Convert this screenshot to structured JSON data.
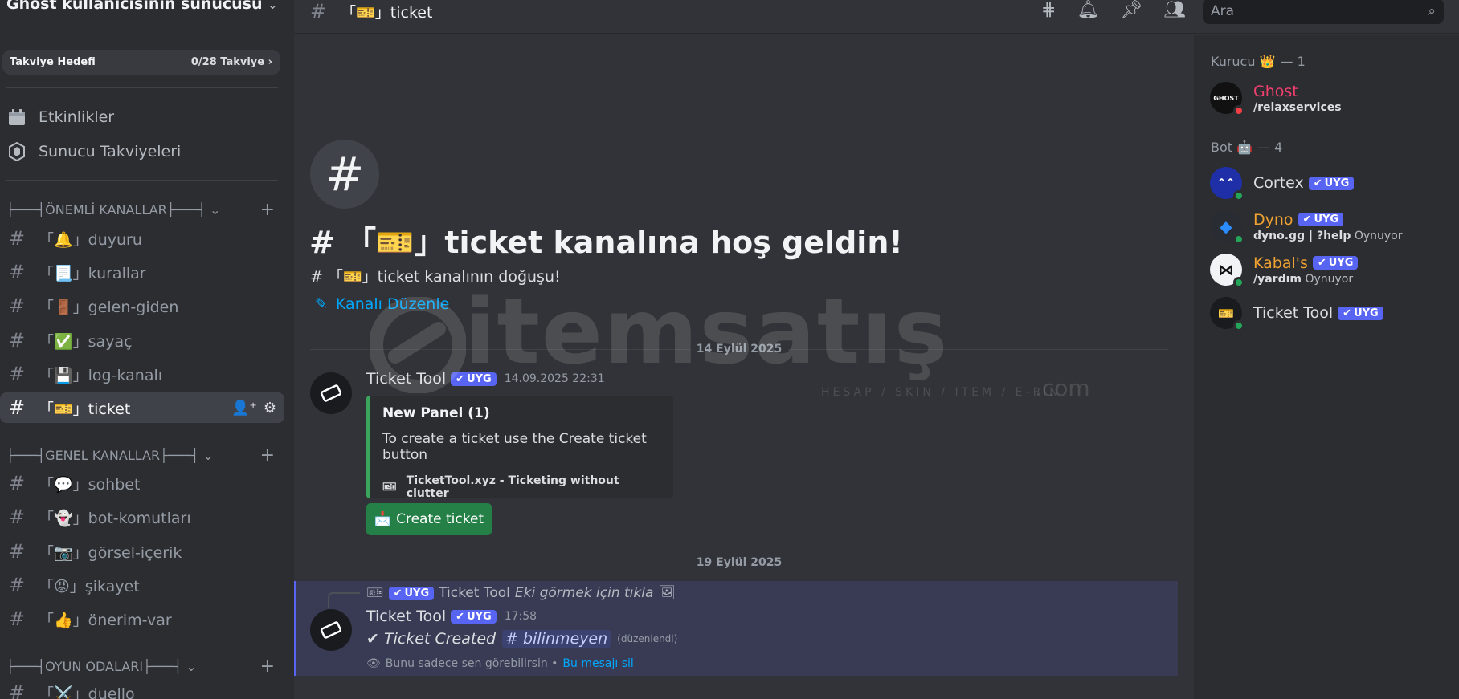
{
  "server": {
    "name": "Ghost kullanıcısının sunucusu"
  },
  "boost": {
    "label": "Takviye Hedefi",
    "count": "0/28 Takviye"
  },
  "sidebar_links": [
    {
      "label": "Etkinlikler",
      "icon": "calendar-icon"
    },
    {
      "label": "Sunucu Takviyeleri",
      "icon": "boost-icon"
    }
  ],
  "categories": {
    "important": "├───┤ÖNEMLİ KANALLAR├───┤",
    "general": "├───┤GENEL KANALLAR├───┤",
    "games": "├───┤OYUN ODALARI├───┤"
  },
  "channels": {
    "important": [
      "「🔔」duyuru",
      "「📃」kurallar",
      "「🚪」gelen-giden",
      "「✅」sayaç",
      "「💾」log-kanalı",
      "「🎫」ticket"
    ],
    "general": [
      "「💬」sohbet",
      "「👻」bot-komutları",
      "「📷」görsel-içerik",
      "「😡」şikayet",
      "「👍」önerim-var"
    ],
    "games": [
      "「⚔️」duello"
    ]
  },
  "topbar": {
    "channel": "「🎫」ticket",
    "search_placeholder": "Ara"
  },
  "welcome": {
    "title": "# 「🎫」ticket kanalına hoş geldin!",
    "subtitle": "# 「🎫」ticket kanalının doğuşu!",
    "edit_link": "Kanalı Düzenle"
  },
  "dates": {
    "first": "14 Eylül 2025",
    "second": "19 Eylül 2025"
  },
  "message1": {
    "author": "Ticket Tool",
    "badge": "UYG",
    "timestamp": "14.09.2025 22:31",
    "embed_title": "New Panel (1)",
    "embed_desc": "To create a ticket use the Create ticket button",
    "embed_footer": "TicketTool.xyz - Ticketing without clutter",
    "button": "Create ticket"
  },
  "message2": {
    "reply_badge": "UYG",
    "reply_author": "Ticket Tool",
    "reply_text": "Eki görmek için tıkla",
    "author": "Ticket Tool",
    "badge": "UYG",
    "timestamp": "17:58",
    "body": "✔ Ticket Created",
    "mention": "# bilinmeyen",
    "edited": "(düzenlendi)",
    "ephemeral_note": "Bunu sadece sen görebilirsin •",
    "delete_link": "Bu mesajı sil"
  },
  "watermark": {
    "text": "itemsatış",
    "sub": "HESAP / SKIN / ITEM / E-PIN",
    "com": ".com"
  },
  "members": {
    "roles": [
      {
        "name": "Kurucu 👑",
        "count": "— 1"
      },
      {
        "name": "Bot 🤖",
        "count": "— 4"
      }
    ],
    "list": [
      {
        "name": "Ghost",
        "status": "/relaxservices",
        "activity": "",
        "color": "#f23f6e",
        "avatar_text": "GHOST",
        "dot": "#f23f43",
        "badge": ""
      },
      {
        "name": "Cortex",
        "status": "",
        "activity": "",
        "color": "#dbdee1",
        "avatar_text": "^^",
        "dot": "#23a55a",
        "badge": "UYG"
      },
      {
        "name": "Dyno",
        "status": "dyno.gg | ?help",
        "activity": "Oynuyor",
        "color": "#f0a232",
        "avatar_text": "◆",
        "dot": "#23a55a",
        "badge": "UYG"
      },
      {
        "name": "Kabal's",
        "status": "/yardım",
        "activity": "Oynuyor",
        "color": "#f0a232",
        "avatar_text": "⋈",
        "dot": "#23a55a",
        "badge": "UYG"
      },
      {
        "name": "Ticket Tool",
        "status": "",
        "activity": "",
        "color": "#dbdee1",
        "avatar_text": "🎫",
        "dot": "#23a55a",
        "badge": "UYG"
      }
    ]
  },
  "colors": {
    "accent": "#5865f2",
    "embed_border": "#3ba55c",
    "button": "#248046",
    "link": "#00a8fc"
  }
}
